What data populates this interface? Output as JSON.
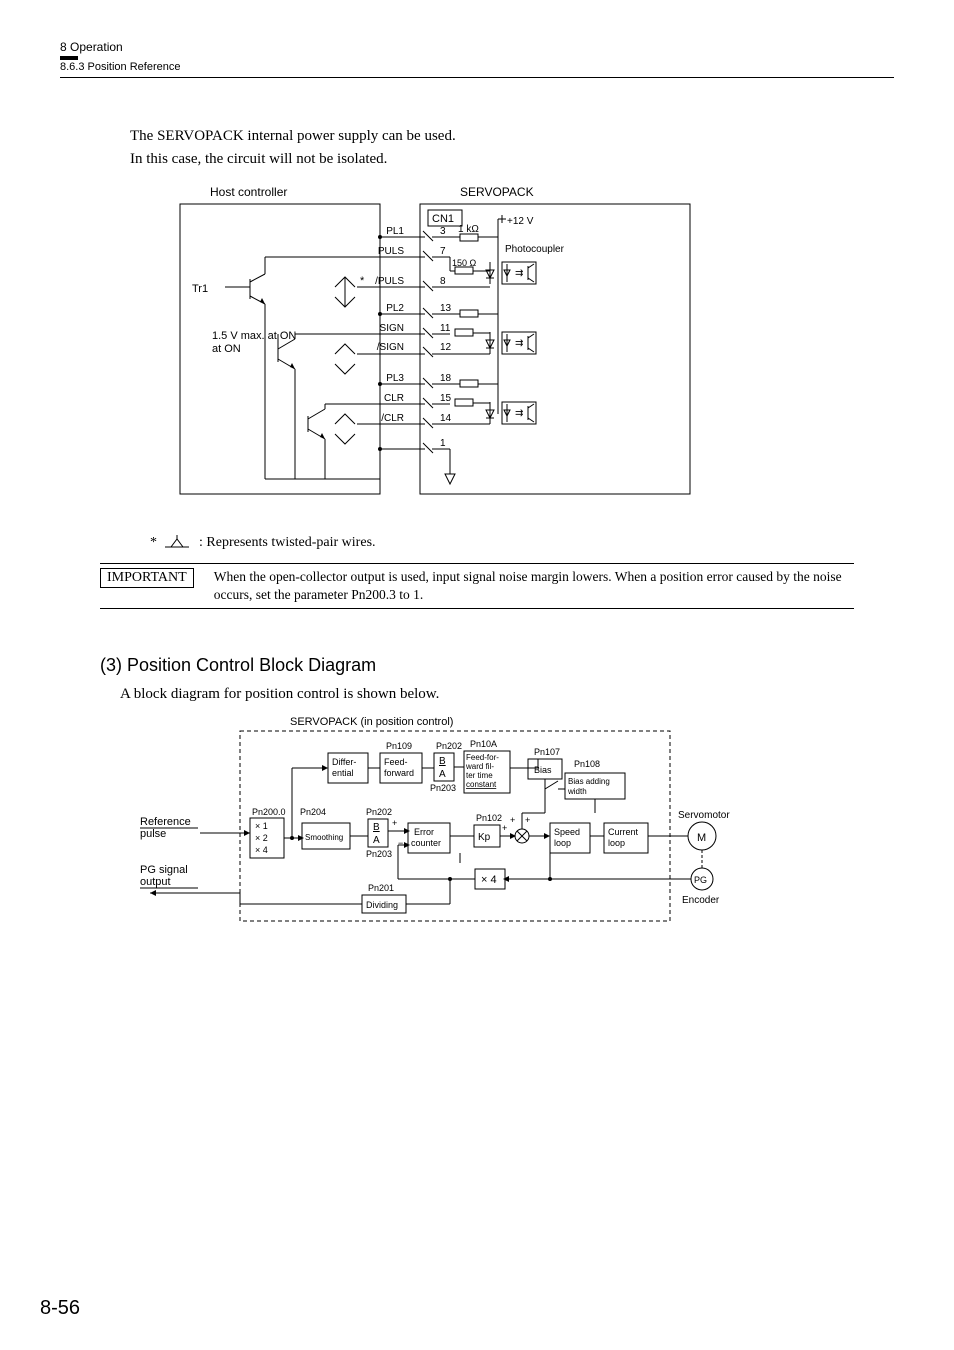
{
  "header": {
    "chapter": "8  Operation",
    "section": "8.6.3  Position Reference"
  },
  "intro": {
    "line1": "The SERVOPACK internal power supply can be used.",
    "line2": "In this case, the circuit will not be isolated."
  },
  "diagram1": {
    "host_label": "Host controller",
    "servopack_label": "SERVOPACK",
    "cn1": "CN1",
    "tr1": "Tr1",
    "vmax": "1.5 V max.\nat ON",
    "pl1": "PL1",
    "pl2": "PL2",
    "pl3": "PL3",
    "puls": "PULS",
    "npuls": "/PULS",
    "sign": "SIGN",
    "nsign": "/SIGN",
    "clr": "CLR",
    "nclr": "/CLR",
    "p3": "3",
    "p7": "7",
    "p8": "8",
    "p13": "13",
    "p11": "11",
    "p12": "12",
    "p18": "18",
    "p15": "15",
    "p14": "14",
    "p1": "1",
    "r1": "1 kΩ",
    "r2": "150 Ω",
    "v12": "+12 V",
    "photo": "Photocoupler",
    "star": "*"
  },
  "legend": {
    "star": "*",
    "text": ": Represents twisted-pair wires."
  },
  "important": {
    "badge": "IMPORTANT",
    "text": "When the open-collector output is used, input signal noise margin lowers. When a position error caused by the noise occurs, set the parameter Pn200.3 to 1."
  },
  "section3": {
    "heading": "(3) Position Control Block Diagram",
    "intro": "A block diagram for position control is shown below."
  },
  "diagram2": {
    "title": "SERVOPACK (in position control)",
    "reference": "Reference\npulse",
    "pg": "PG signal\noutput",
    "pn200": "Pn200.0",
    "mult": "× 1\n× 2\n× 4",
    "pn204": "Pn204",
    "smoothing": "Smoothing",
    "pn202a": "Pn202",
    "ba": "B\nA",
    "pn203a": "Pn203",
    "pn109": "Pn109",
    "differential": "Differ-\nential",
    "feedforward": "Feed-\nforward",
    "pn202b": "Pn202",
    "pn203b": "Pn203",
    "pn10a": "Pn10A",
    "fffilter": "Feed-for-\nward fil-\nter time\nconstant",
    "pn107": "Pn107",
    "bias": "Bias",
    "pn108": "Pn108",
    "biaswidth": "Bias adding\nwidth",
    "error": "Error\ncounter",
    "pn102": "Pn102",
    "kp": "Kp",
    "speed": "Speed\nloop",
    "current": "Current\nloop",
    "servomotor": "Servomotor",
    "m": "M",
    "pgcircle": "PG",
    "encoder": "Encoder",
    "x4": "× 4",
    "pn201": "Pn201",
    "dividing": "Dividing"
  },
  "page": "8-56"
}
